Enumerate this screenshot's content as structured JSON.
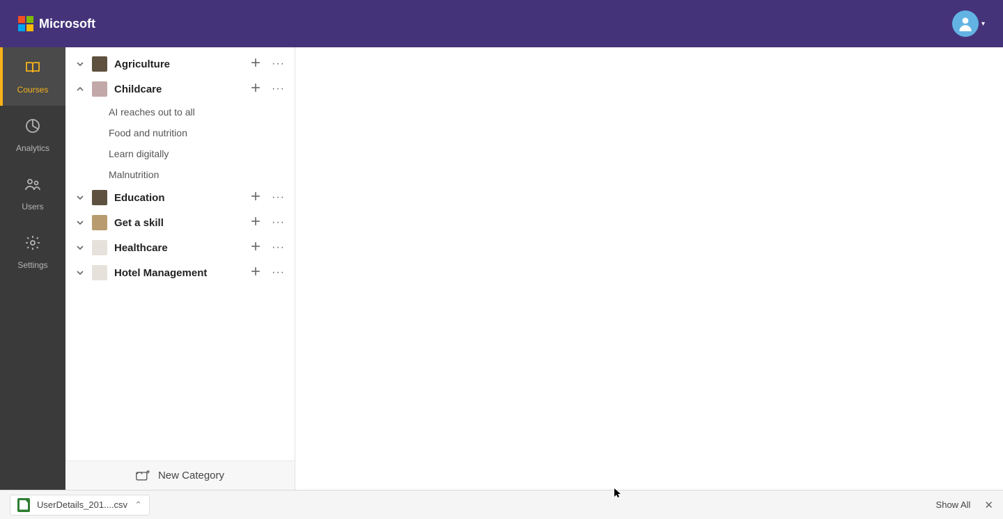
{
  "header": {
    "brand": "Microsoft"
  },
  "rail": {
    "items": [
      {
        "id": "courses",
        "label": "Courses",
        "active": true
      },
      {
        "id": "analytics",
        "label": "Analytics",
        "active": false
      },
      {
        "id": "users",
        "label": "Users",
        "active": false
      },
      {
        "id": "settings",
        "label": "Settings",
        "active": false
      }
    ]
  },
  "categories": [
    {
      "name": "Agriculture",
      "expanded": false,
      "thumb": "dark",
      "children": []
    },
    {
      "name": "Childcare",
      "expanded": true,
      "thumb": "pink",
      "children": [
        "AI reaches out to all",
        "Food and nutrition",
        "Learn digitally",
        "Malnutrition"
      ]
    },
    {
      "name": "Education",
      "expanded": false,
      "thumb": "dark",
      "children": []
    },
    {
      "name": "Get a skill",
      "expanded": false,
      "thumb": "default",
      "children": []
    },
    {
      "name": "Healthcare",
      "expanded": false,
      "thumb": "light",
      "children": []
    },
    {
      "name": "Hotel Management",
      "expanded": false,
      "thumb": "light",
      "children": []
    }
  ],
  "newCategoryLabel": "New Category",
  "downloadBar": {
    "fileName": "UserDetails_201....csv",
    "showAllLabel": "Show All"
  }
}
